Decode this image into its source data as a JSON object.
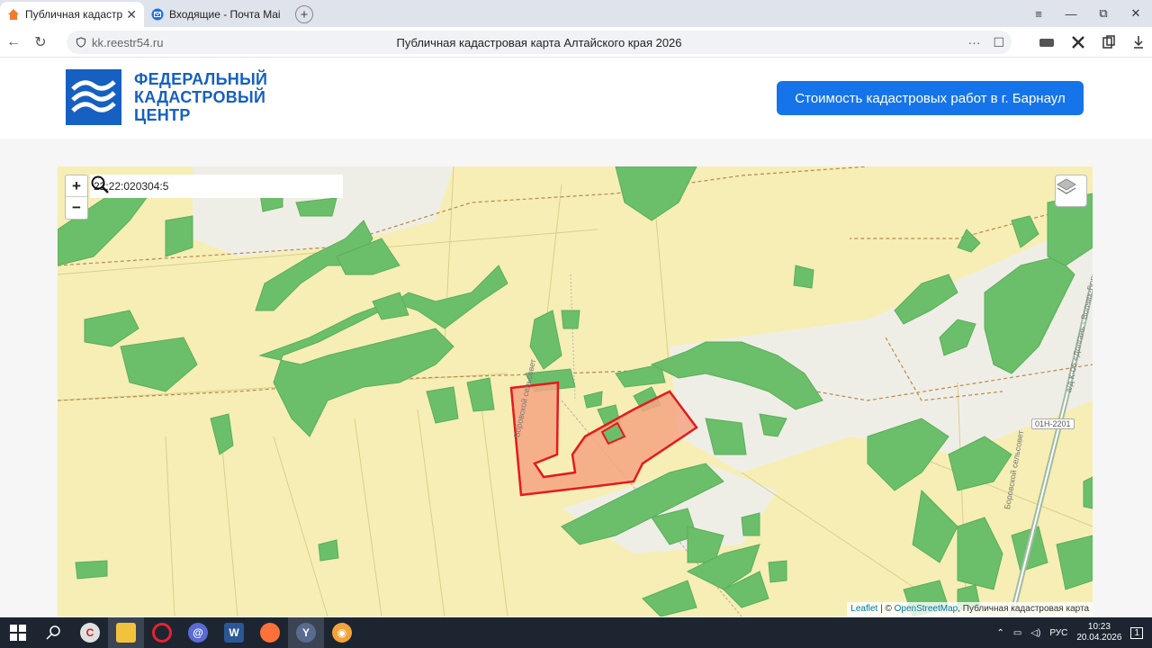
{
  "browser": {
    "tabs": [
      {
        "title": "Публичная кадастрова",
        "active": true
      },
      {
        "title": "Входящие - Почта Mail",
        "active": false
      }
    ],
    "new_tab": "+",
    "window_controls": [
      "≡",
      "—",
      "⧉",
      "✕"
    ],
    "url_domain": "kk.reestr54.ru",
    "page_title": "Публичная кадастровая карта Алтайского края 2026",
    "url_actions": [
      "···",
      "☐"
    ]
  },
  "site": {
    "logo_lines": [
      "ФЕДЕРАЛЬНЫЙ",
      "КАДАСТРОВЫЙ",
      "ЦЕНТР"
    ],
    "cta_label": "Стоимость кадастровых работ в г. Барнаул",
    "colors": {
      "brand": "#1560c1",
      "cta": "#1574ea",
      "map_bg": "#f6eeb5",
      "forest": "#6bbf6b",
      "parcel": "#f4a582",
      "parcel_border": "#e41a1c"
    }
  },
  "map": {
    "zoom_in": "+",
    "zoom_out": "−",
    "search_value": "22:22:020304:5",
    "labels": {
      "selsovet_1": "Боровской сельсовет",
      "selsovet_2": "Боровской сельсовет",
      "road_name": "а/д К-06 «Долгань - Волчих-Бор»",
      "road_code": "01Н-2201"
    },
    "attribution": {
      "leaflet": "Leaflet",
      "sep1": " | © ",
      "osm": "OpenStreetMap",
      "rest": ", Публичная кадастровая карта"
    }
  },
  "taskbar": {
    "apps": [
      "windows",
      "search",
      "ccleaner",
      "explorer",
      "opera",
      "messenger",
      "word",
      "firefox",
      "yandex",
      "eye"
    ],
    "tray_lang": "РУС",
    "time": "10:23",
    "date": "20.04.2026",
    "notifications": "1"
  }
}
